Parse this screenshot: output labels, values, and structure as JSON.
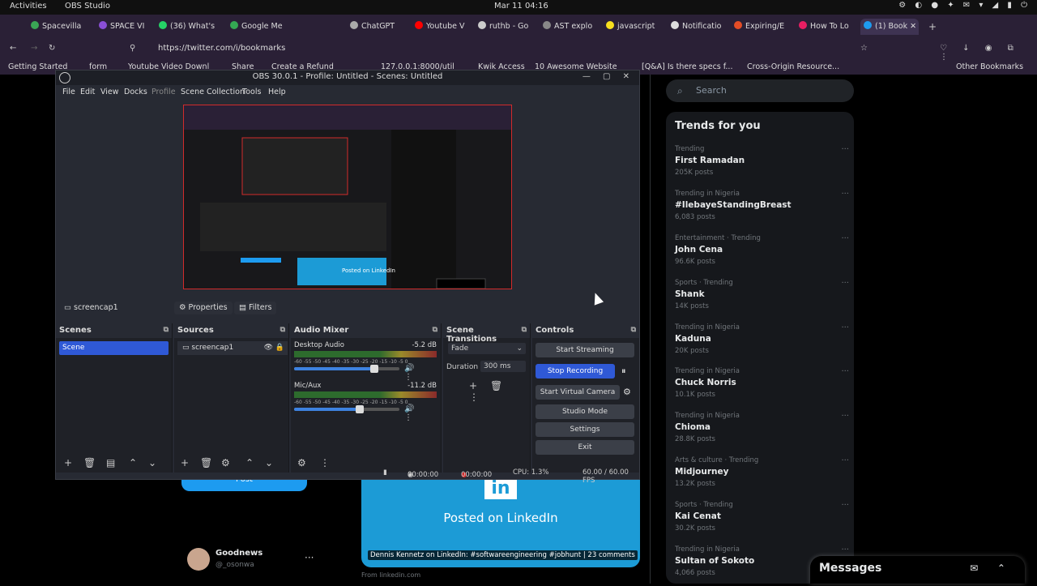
{
  "topbar": {
    "activities": "Activities",
    "app": "OBS Studio",
    "clock": "Mar 11  04:16",
    "tray": "⚙ ◐ ● ✦ ✉ ▾ ◢ ▮ ⏻"
  },
  "tabs": [
    {
      "label": "Spacevilla",
      "color": "#3aa655"
    },
    {
      "label": "SPACE VI",
      "color": "#8a4fd6"
    },
    {
      "label": "(36) What's",
      "color": "#25d366"
    },
    {
      "label": "Google Me",
      "color": "#34a853"
    },
    {
      "label": "ChatGPT",
      "color": "#aaa"
    },
    {
      "label": "Youtube V",
      "color": "#ff0000"
    },
    {
      "label": "ruthb - Go",
      "color": "#ccc"
    },
    {
      "label": "AST explo",
      "color": "#888"
    },
    {
      "label": "javascript",
      "color": "#f7df1e"
    },
    {
      "label": "Notificatio",
      "color": "#ddd"
    },
    {
      "label": "Expiring/E",
      "color": "#e44d26"
    },
    {
      "label": "How To Lo",
      "color": "#e91e63"
    },
    {
      "label": "(1) Book",
      "color": "#1d9bf0"
    }
  ],
  "url": "https://twitter.com/i/bookmarks",
  "bookmarks": [
    {
      "label": "Getting Started"
    },
    {
      "label": "form"
    },
    {
      "label": "Youtube Video Downl"
    },
    {
      "label": "Share"
    },
    {
      "label": "Create a Refund"
    },
    {
      "label": "127.0.0.1:8000/util"
    },
    {
      "label": "Kwik Access"
    },
    {
      "label": "10 Awesome Website"
    },
    {
      "label": "[Q&A] Is there specs f..."
    },
    {
      "label": "Cross-Origin Resource..."
    },
    {
      "label": "Other Bookmarks"
    }
  ],
  "search": {
    "placeholder": "Search"
  },
  "trends": {
    "heading": "Trends for you",
    "items": [
      {
        "context": "Trending",
        "name": "First Ramadan",
        "posts": "205K posts"
      },
      {
        "context": "Trending in Nigeria",
        "name": "#IlebayeStandingBreast",
        "posts": "6,083 posts"
      },
      {
        "context": "Entertainment · Trending",
        "name": "John Cena",
        "posts": "96.6K posts"
      },
      {
        "context": "Sports · Trending",
        "name": "Shank",
        "posts": "14K posts"
      },
      {
        "context": "Trending in Nigeria",
        "name": "Kaduna",
        "posts": "20K posts"
      },
      {
        "context": "Trending in Nigeria",
        "name": "Chuck Norris",
        "posts": "10.1K posts"
      },
      {
        "context": "Trending in Nigeria",
        "name": "Chioma",
        "posts": "28.8K posts"
      },
      {
        "context": "Arts & culture · Trending",
        "name": "Midjourney",
        "posts": "13.2K posts"
      },
      {
        "context": "Sports · Trending",
        "name": "Kai Cenat",
        "posts": "30.2K posts"
      },
      {
        "context": "Trending in Nigeria",
        "name": "Sultan of Sokoto",
        "posts": "4,066 posts"
      }
    ]
  },
  "messages": {
    "title": "Messages"
  },
  "feed": {
    "post_button": "Post",
    "account_name": "Goodnews",
    "account_handle": "@_osonwa",
    "linkedin_posted": "Posted on LinkedIn",
    "linkedin_caption": "Dennis Kennetz on LinkedIn: #softwareengineering #jobhunt | 23 comments",
    "from": "From linkedin.com"
  },
  "obs": {
    "title": "OBS 30.0.1 - Profile: Untitled - Scenes: Untitled",
    "menu": [
      "File",
      "Edit",
      "View",
      "Docks",
      "Profile",
      "Scene Collection",
      "Tools",
      "Help"
    ],
    "source_caption": "screencap1",
    "properties": "Properties",
    "filters": "Filters",
    "scenes": {
      "header": "Scenes",
      "items": [
        "Scene"
      ]
    },
    "sources": {
      "header": "Sources",
      "items": [
        "screencap1"
      ]
    },
    "mixer": {
      "header": "Audio Mixer",
      "channels": [
        {
          "name": "Desktop Audio",
          "db": "-5.2 dB",
          "level": 0.76
        },
        {
          "name": "Mic/Aux",
          "db": "-11.2 dB",
          "level": 0.62
        }
      ],
      "scale": "-60 -55 -50 -45 -40 -35 -30 -25 -20 -15 -10 -5 0"
    },
    "transitions": {
      "header": "Scene Transitions",
      "type": "Fade",
      "duration_label": "Duration",
      "duration": "300 ms"
    },
    "controls": {
      "header": "Controls",
      "start_streaming": "Start Streaming",
      "stop_recording": "Stop Recording",
      "start_virtual_camera": "Start Virtual Camera",
      "studio_mode": "Studio Mode",
      "settings": "Settings",
      "exit": "Exit"
    },
    "status": {
      "stream_time": "00:00:00",
      "rec_time": "00:00:00",
      "cpu": "CPU: 1.3%",
      "fps": "60.00 / 60.00 FPS"
    }
  },
  "preview": {
    "posted": "Posted on LinkedIn"
  },
  "colors": {
    "accent": "#1d9bf0",
    "obs_selected": "#2f59d6",
    "rec_red": "#d12b2b"
  }
}
